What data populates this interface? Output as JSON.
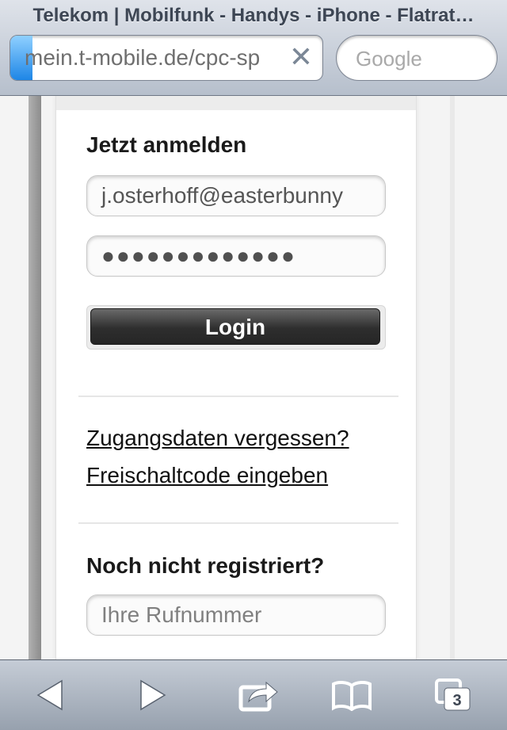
{
  "browser": {
    "page_title": "Telekom | Mobilfunk - Handys - iPhone - Flatrat…",
    "url": "mein.t-mobile.de/cpc-sp",
    "search_placeholder": "Google",
    "tab_count": "3",
    "load_progress_percent": 7
  },
  "login": {
    "heading": "Jetzt anmelden",
    "email_value": "j.osterhoff@easterbunny",
    "password_masked": "●●●●●●●●●●●●●",
    "button_label": "Login"
  },
  "links": {
    "forgot": "Zugangsdaten vergessen?",
    "activation": "Freischaltcode eingeben"
  },
  "register": {
    "heading": "Noch nicht registriert?",
    "phone_placeholder": "Ihre Rufnummer"
  },
  "icons": [
    "back-icon",
    "forward-icon",
    "share-icon",
    "bookmarks-icon",
    "tabs-icon",
    "clear-icon"
  ]
}
